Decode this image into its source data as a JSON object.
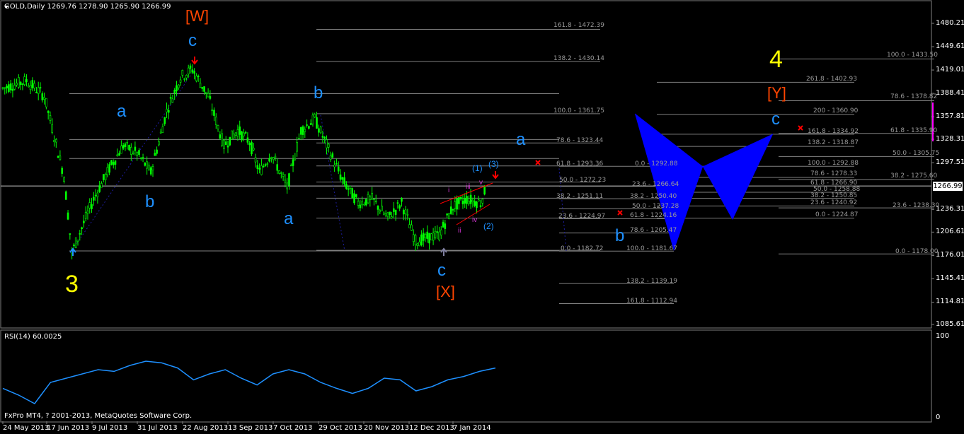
{
  "header": {
    "symbol_info": "GOLD,Daily  1269.76 1278.90 1265.90 1266.99",
    "current_price": "1266.99"
  },
  "rsi": {
    "title": "RSI(14) 60.0025",
    "scale_max": "100",
    "scale_min": "0",
    "color": "#1e90ff"
  },
  "footer": {
    "copyright": "FxPro MT4, ? 2001-2013, MetaQuotes Software Corp."
  },
  "colors": {
    "bull_candle": "#00ff00",
    "wave_blue": "#1e90ff",
    "wave_yellow": "#ffff00",
    "wave_orange": "#ff4500",
    "pattern": "#0000ff",
    "fib_lines": "#808080",
    "minor_waves": "#cc33cc",
    "marker_red": "#ff0000"
  },
  "chart_data": {
    "type": "candlestick",
    "title": "GOLD,Daily",
    "ylim": [
      1085.61,
      1495.0
    ],
    "y_ticks": [
      "1480.21",
      "1449.61",
      "1419.01",
      "1388.41",
      "1357.81",
      "1328.31",
      "1297.51",
      "1266.99",
      "1236.31",
      "1206.61",
      "1176.01",
      "1145.41",
      "1114.81",
      "1085.61"
    ],
    "x_ticks": [
      "24 May 2013",
      "17 Jun 2013",
      "9 Jul 2013",
      "31 Jul 2013",
      "22 Aug 2013",
      "13 Sep 2013",
      "7 Oct 2013",
      "29 Oct 2013",
      "20 Nov 2013",
      "12 Dec 2013",
      "7 Jan 2014"
    ],
    "approx_close_path": [
      [
        "24 May 2013",
        1395
      ],
      [
        "5 Jun 2013",
        1405
      ],
      [
        "14 Jun 2013",
        1385
      ],
      [
        "24 Jun 2013",
        1280
      ],
      [
        "28 Jun 2013",
        1180
      ],
      [
        "5 Jul 2013",
        1225
      ],
      [
        "9 Jul 2013",
        1250
      ],
      [
        "17 Jul 2013",
        1290
      ],
      [
        "24 Jul 2013",
        1320
      ],
      [
        "31 Jul 2013",
        1310
      ],
      [
        "7 Aug 2013",
        1285
      ],
      [
        "15 Aug 2013",
        1365
      ],
      [
        "22 Aug 2013",
        1410
      ],
      [
        "28 Aug 2013",
        1420
      ],
      [
        "5 Sep 2013",
        1385
      ],
      [
        "13 Sep 2013",
        1320
      ],
      [
        "20 Sep 2013",
        1340
      ],
      [
        "26 Sep 2013",
        1325
      ],
      [
        "1 Oct 2013",
        1285
      ],
      [
        "7 Oct 2013",
        1310
      ],
      [
        "15 Oct 2013",
        1265
      ],
      [
        "22 Oct 2013",
        1340
      ],
      [
        "29 Oct 2013",
        1355
      ],
      [
        "5 Nov 2013",
        1315
      ],
      [
        "12 Nov 2013",
        1275
      ],
      [
        "20 Nov 2013",
        1245
      ],
      [
        "27 Nov 2013",
        1250
      ],
      [
        "5 Dec 2013",
        1225
      ],
      [
        "12 Dec 2013",
        1245
      ],
      [
        "19 Dec 2013",
        1195
      ],
      [
        "31 Dec 2013",
        1203
      ],
      [
        "7 Jan 2014",
        1240
      ],
      [
        "14 Jan 2014",
        1250
      ],
      [
        "21 Jan 2014",
        1245
      ],
      [
        "24 Jan 2014",
        1266.99
      ]
    ],
    "rsi_approx": [
      38,
      30,
      20,
      45,
      50,
      55,
      60,
      58,
      65,
      70,
      68,
      62,
      48,
      55,
      60,
      50,
      42,
      55,
      60,
      55,
      45,
      38,
      32,
      38,
      50,
      48,
      35,
      40,
      48,
      52,
      58,
      62
    ],
    "fibonacci_labels": [
      "161.8 - 1472.39",
      "138.2 - 1430.14",
      "100.0 - 1361.75",
      "78.6 - 1323.44",
      "61.8 - 1293.36",
      "50.0 - 1272.23",
      "38.2 - 1251.11",
      "23.6 - 1224.97",
      "0.0 - 1182.72",
      "0.0 - 1292.88",
      "23.6 - 1266.64",
      "38.2 - 1250.40",
      "50.0 - 1237.28",
      "61.8 - 1224.16",
      "78.6 - 1205.47",
      "100.0 - 1181.67",
      "138.2 - 1139.19",
      "161.8 - 1112.94",
      "261.8 - 1402.93",
      "200 - 1360.90",
      "161.8 - 1334.92",
      "138.2 - 1318.87",
      "100.0 - 1292.88",
      "78.6 - 1278.33",
      "61.8 - 1266.90",
      "50.0 - 1258.88",
      "38.2 - 1250.85",
      "23.6 - 1240.92",
      "0.0 - 1224.87",
      "100.0 - 1433.50",
      "78.6 - 1378.82",
      "61.8 - 1335.90",
      "50.0 - 1305.75",
      "38.2 - 1275.60",
      "23.6 - 1238.30",
      "0.0 - 1178.00"
    ],
    "wave_labels": [
      "[W]",
      "c",
      "a",
      "b",
      "a",
      "b",
      "b",
      "a",
      "c",
      "[X]",
      "3",
      "4",
      "[Y]",
      "c",
      "a",
      "b",
      "(1)",
      "(2)",
      "(3)",
      "i",
      "ii",
      "iii",
      "iv",
      "v"
    ]
  }
}
